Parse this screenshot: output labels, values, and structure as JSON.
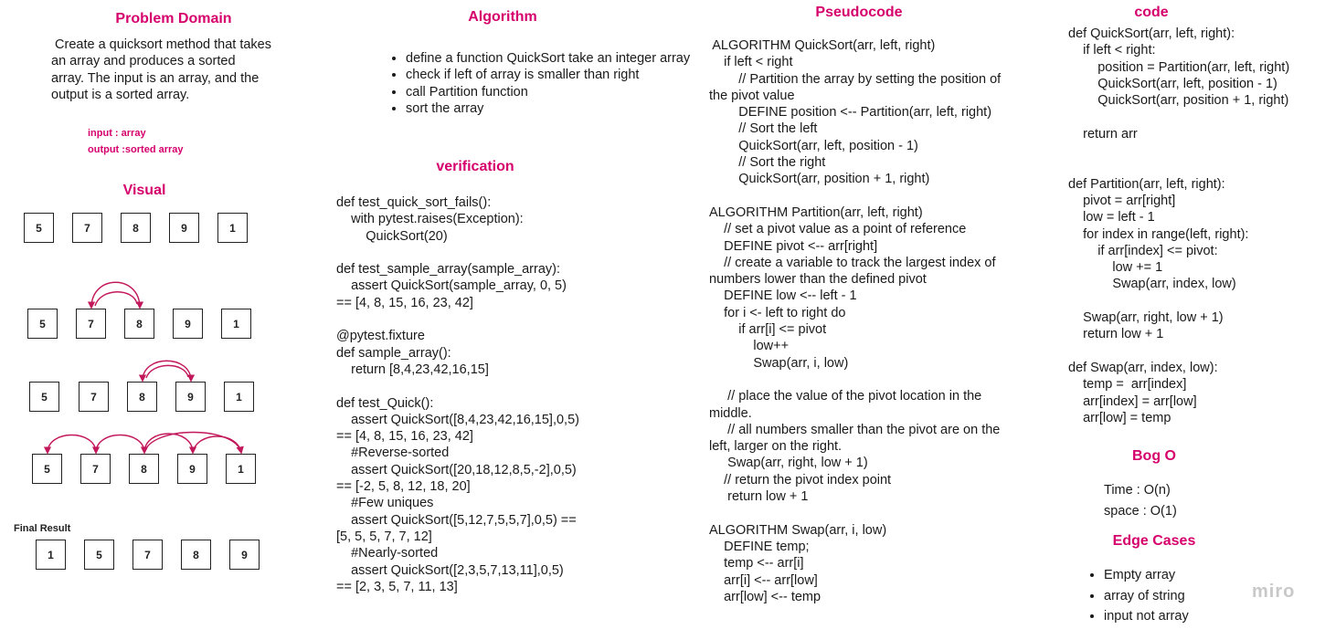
{
  "problem_domain": {
    "heading": "Problem Domain",
    "description": " Create a quicksort method that takes\nan array and produces a sorted\narray. The input is an array, and the\noutput is a sorted array.",
    "input_label": "input :  array",
    "output_label": "output :sorted array"
  },
  "visual": {
    "heading": "Visual",
    "final_label": "Final Result",
    "rows": [
      [
        "5",
        "7",
        "8",
        "9",
        "1"
      ],
      [
        "5",
        "7",
        "8",
        "9",
        "1"
      ],
      [
        "5",
        "7",
        "8",
        "9",
        "1"
      ],
      [
        "5",
        "7",
        "8",
        "9",
        "1"
      ],
      [
        "1",
        "5",
        "7",
        "8",
        "9"
      ]
    ]
  },
  "algorithm": {
    "heading": "Algorithm",
    "steps": [
      "define a function QuickSort take an integer array",
      " check if left of array is smaller than right",
      "call Partition function",
      "sort the array"
    ]
  },
  "verification": {
    "heading": "verification",
    "code": "def test_quick_sort_fails():\n    with pytest.raises(Exception):\n        QuickSort(20)\n\ndef test_sample_array(sample_array):\n    assert QuickSort(sample_array, 0, 5)\n== [4, 8, 15, 16, 23, 42]\n\n@pytest.fixture\ndef sample_array():\n    return [8,4,23,42,16,15]\n\ndef test_Quick():\n    assert QuickSort([8,4,23,42,16,15],0,5)\n== [4, 8, 15, 16, 23, 42]\n    #Reverse-sorted\n    assert QuickSort([20,18,12,8,5,-2],0,5)\n== [-2, 5, 8, 12, 18, 20]\n    #Few uniques\n    assert QuickSort([5,12,7,5,5,7],0,5) ==\n[5, 5, 5, 7, 7, 12]\n    #Nearly-sorted\n    assert QuickSort([2,3,5,7,13,11],0,5)\n== [2, 3, 5, 7, 11, 13]"
  },
  "pseudocode": {
    "heading": "Pseudocode",
    "code": " ALGORITHM QuickSort(arr, left, right)\n    if left < right\n        // Partition the array by setting the position of\nthe pivot value\n        DEFINE position <-- Partition(arr, left, right)\n        // Sort the left\n        QuickSort(arr, left, position - 1)\n        // Sort the right\n        QuickSort(arr, position + 1, right)\n\nALGORITHM Partition(arr, left, right)\n    // set a pivot value as a point of reference\n    DEFINE pivot <-- arr[right]\n    // create a variable to track the largest index of\nnumbers lower than the defined pivot\n    DEFINE low <-- left - 1\n    for i <- left to right do\n        if arr[i] <= pivot\n            low++\n            Swap(arr, i, low)\n\n     // place the value of the pivot location in the\nmiddle.\n     // all numbers smaller than the pivot are on the\nleft, larger on the right.\n     Swap(arr, right, low + 1)\n    // return the pivot index point\n     return low + 1\n\nALGORITHM Swap(arr, i, low)\n    DEFINE temp;\n    temp <-- arr[i]\n    arr[i] <-- arr[low]\n    arr[low] <-- temp"
  },
  "code": {
    "heading": "code",
    "code": "def QuickSort(arr, left, right):\n    if left < right:\n        position = Partition(arr, left, right)\n        QuickSort(arr, left, position - 1)\n        QuickSort(arr, position + 1, right)\n\n    return arr\n\n\ndef Partition(arr, left, right):\n    pivot = arr[right]\n    low = left - 1\n    for index in range(left, right):\n        if arr[index] <= pivot:\n            low += 1\n            Swap(arr, index, low)\n\n    Swap(arr, right, low + 1)\n    return low + 1\n\ndef Swap(arr, index, low):\n    temp =  arr[index]\n    arr[index] = arr[low]\n    arr[low] = temp"
  },
  "big_o": {
    "heading": "Bog O",
    "time": "Time : O(n)",
    "space": "space : O(1)"
  },
  "edge_cases": {
    "heading": "Edge Cases",
    "items": [
      "Empty array",
      "array of string",
      "input not array"
    ]
  },
  "watermark": "miro",
  "colors": {
    "accent": "#d6006c",
    "arrow": "#c2185b"
  }
}
